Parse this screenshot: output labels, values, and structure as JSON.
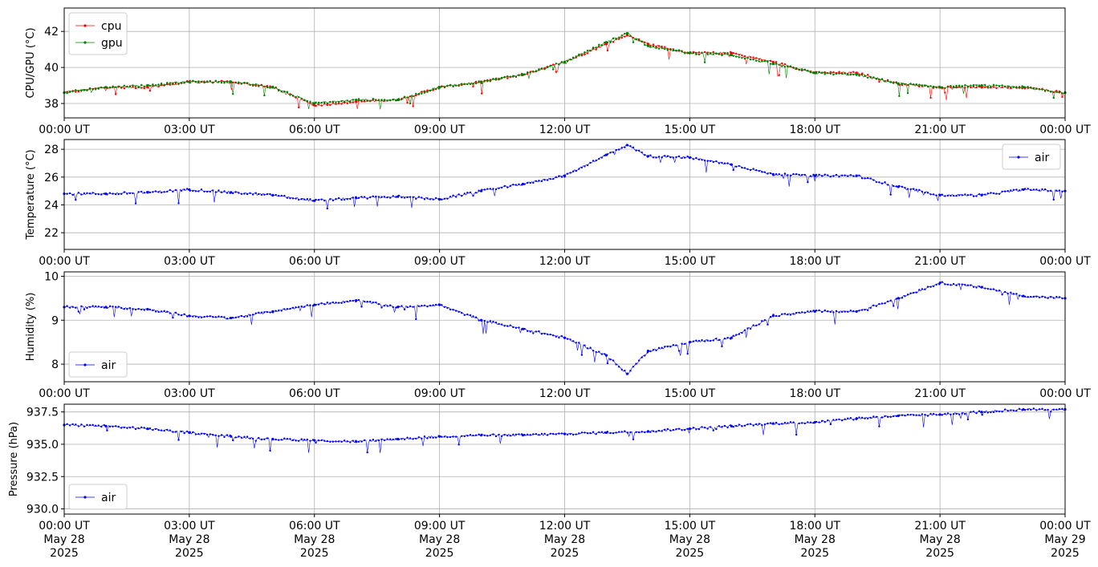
{
  "x_axis": {
    "tick_labels": [
      "00:00 UT",
      "03:00 UT",
      "06:00 UT",
      "09:00 UT",
      "12:00 UT",
      "15:00 UT",
      "18:00 UT",
      "21:00 UT",
      "00:00 UT"
    ],
    "tick_hours": [
      0,
      3,
      6,
      9,
      12,
      15,
      18,
      21,
      24
    ],
    "date_lines_1": [
      "May 28",
      "May 28",
      "May 28",
      "May 28",
      "May 28",
      "May 28",
      "May 28",
      "May 28",
      "May 29"
    ],
    "date_lines_2": [
      "2025",
      "2025",
      "2025",
      "2025",
      "2025",
      "2025",
      "2025",
      "2025",
      "2025"
    ],
    "range_hours": [
      0,
      24
    ]
  },
  "chart_data": [
    {
      "type": "line",
      "ylabel": "CPU/GPU (°C)",
      "ylim": [
        37.2,
        43.3
      ],
      "yticks": [
        38,
        40,
        42
      ],
      "ytick_labels": [
        "38",
        "40",
        "42"
      ],
      "grid": true,
      "legend_position": "top-left",
      "series": [
        {
          "name": "cpu",
          "color": "#ff0000",
          "x_hours": [
            0,
            1,
            2,
            3,
            4,
            5,
            6,
            7,
            8,
            9,
            10,
            11,
            12,
            13,
            13.5,
            14,
            15,
            16,
            17,
            18,
            19,
            20,
            21,
            22,
            23,
            24
          ],
          "values": [
            38.6,
            38.9,
            38.9,
            39.2,
            39.2,
            38.9,
            37.9,
            38.1,
            38.2,
            38.9,
            39.2,
            39.6,
            40.3,
            41.3,
            41.8,
            41.3,
            40.8,
            40.8,
            40.3,
            39.7,
            39.7,
            39.1,
            38.9,
            38.9,
            38.9,
            38.6
          ]
        },
        {
          "name": "gpu",
          "color": "#008000",
          "x_hours": [
            0,
            1,
            2,
            3,
            4,
            5,
            6,
            7,
            8,
            9,
            10,
            11,
            12,
            13,
            13.5,
            14,
            15,
            16,
            17,
            18,
            19,
            20,
            21,
            22,
            23,
            24
          ],
          "values": [
            38.6,
            38.9,
            39.0,
            39.2,
            39.2,
            38.9,
            38.0,
            38.2,
            38.2,
            38.9,
            39.2,
            39.6,
            40.3,
            41.4,
            41.9,
            41.2,
            40.8,
            40.7,
            40.2,
            39.7,
            39.6,
            39.1,
            38.9,
            39.0,
            38.9,
            38.6
          ]
        }
      ]
    },
    {
      "type": "line",
      "ylabel": "Temperature (°C)",
      "ylim": [
        20.8,
        28.7
      ],
      "yticks": [
        22,
        24,
        26,
        28
      ],
      "ytick_labels": [
        "22",
        "24",
        "26",
        "28"
      ],
      "grid": true,
      "legend_position": "top-right",
      "series": [
        {
          "name": "air",
          "color": "#0000ff",
          "x_hours": [
            0,
            1,
            2,
            3,
            4,
            5,
            6,
            7,
            8,
            9,
            10,
            11,
            12,
            13,
            13.5,
            14,
            15,
            16,
            17,
            18,
            19,
            20,
            21,
            22,
            23,
            24
          ],
          "values": [
            24.8,
            24.8,
            24.9,
            25.1,
            24.9,
            24.7,
            24.3,
            24.5,
            24.6,
            24.4,
            25.0,
            25.5,
            26.1,
            27.6,
            28.3,
            27.5,
            27.4,
            26.9,
            26.2,
            26.1,
            26.1,
            25.3,
            24.7,
            24.7,
            25.1,
            25.0
          ]
        }
      ]
    },
    {
      "type": "line",
      "ylabel": "Humidity (%)",
      "ylim": [
        7.6,
        10.1
      ],
      "yticks": [
        8,
        9,
        10
      ],
      "ytick_labels": [
        "8",
        "9",
        "10"
      ],
      "grid": true,
      "legend_position": "bottom-left",
      "series": [
        {
          "name": "air",
          "color": "#0000ff",
          "x_hours": [
            0,
            1,
            2,
            3,
            4,
            5,
            6,
            7,
            8,
            9,
            10,
            11,
            12,
            13,
            13.5,
            14,
            15,
            16,
            17,
            18,
            19,
            20,
            21,
            22,
            23,
            24
          ],
          "values": [
            9.3,
            9.3,
            9.25,
            9.1,
            9.05,
            9.2,
            9.35,
            9.45,
            9.3,
            9.35,
            9.0,
            8.8,
            8.6,
            8.2,
            7.78,
            8.3,
            8.5,
            8.6,
            9.1,
            9.2,
            9.2,
            9.5,
            9.85,
            9.75,
            9.55,
            9.5
          ]
        }
      ]
    },
    {
      "type": "line",
      "ylabel": "Pressure (hPa)",
      "ylim": [
        929.6,
        938.1
      ],
      "yticks": [
        930.0,
        932.5,
        935.0,
        937.5
      ],
      "ytick_labels": [
        "930.0",
        "932.5",
        "935.0",
        "937.5"
      ],
      "grid": true,
      "legend_position": "bottom-left",
      "series": [
        {
          "name": "air",
          "color": "#0000ff",
          "x_hours": [
            0,
            1,
            2,
            3,
            4,
            5,
            6,
            7,
            8,
            9,
            10,
            11,
            12,
            13,
            14,
            15,
            16,
            17,
            18,
            19,
            20,
            21,
            22,
            23,
            24
          ],
          "values": [
            936.5,
            936.4,
            936.2,
            935.9,
            935.6,
            935.4,
            935.3,
            935.2,
            935.4,
            935.6,
            935.7,
            935.7,
            935.8,
            935.9,
            936.0,
            936.2,
            936.4,
            936.6,
            936.7,
            937.0,
            937.2,
            937.3,
            937.5,
            937.7,
            937.7
          ]
        }
      ]
    }
  ]
}
